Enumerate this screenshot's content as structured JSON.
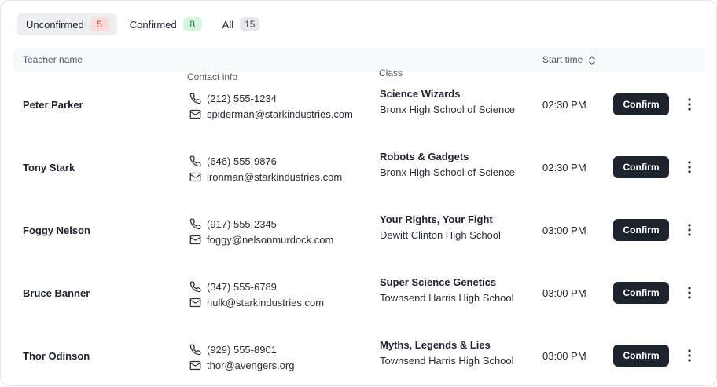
{
  "tabs": [
    {
      "label": "Unconfirmed",
      "count": "5",
      "tone": "red",
      "active": true
    },
    {
      "label": "Confirmed",
      "count": "8",
      "tone": "green",
      "active": false
    },
    {
      "label": "All",
      "count": "15",
      "tone": "gray",
      "active": false
    }
  ],
  "columns": {
    "teacher": "Teacher name",
    "contact": "Contact info",
    "class": "Class",
    "start": "Start time"
  },
  "confirm_label": "Confirm",
  "icons": {
    "phone": "phone-icon",
    "email": "mail-icon",
    "sort": "sort-icon",
    "more": "more-vertical-icon"
  },
  "rows": [
    {
      "teacher": "Peter Parker",
      "phone": "(212) 555-1234",
      "email": "spiderman@starkindustries.com",
      "class": "Science Wizards",
      "school": "Bronx High School of Science",
      "time": "02:30 PM"
    },
    {
      "teacher": "Tony Stark",
      "phone": "(646) 555-9876",
      "email": "ironman@starkindustries.com",
      "class": "Robots & Gadgets",
      "school": "Bronx High School of Science",
      "time": "02:30 PM"
    },
    {
      "teacher": "Foggy Nelson",
      "phone": "(917) 555-2345",
      "email": "foggy@nelsonmurdock.com",
      "class": "Your Rights, Your Fight",
      "school": "Dewitt Clinton High School",
      "time": "03:00 PM"
    },
    {
      "teacher": "Bruce Banner",
      "phone": "(347) 555-6789",
      "email": "hulk@starkindustries.com",
      "class": "Super Science Genetics",
      "school": "Townsend Harris High School",
      "time": "03:00 PM"
    },
    {
      "teacher": "Thor Odinson",
      "phone": "(929) 555-8901",
      "email": "thor@avengers.org",
      "class": "Myths, Legends & Lies",
      "school": "Townsend Harris High School",
      "time": "03:00 PM"
    }
  ]
}
